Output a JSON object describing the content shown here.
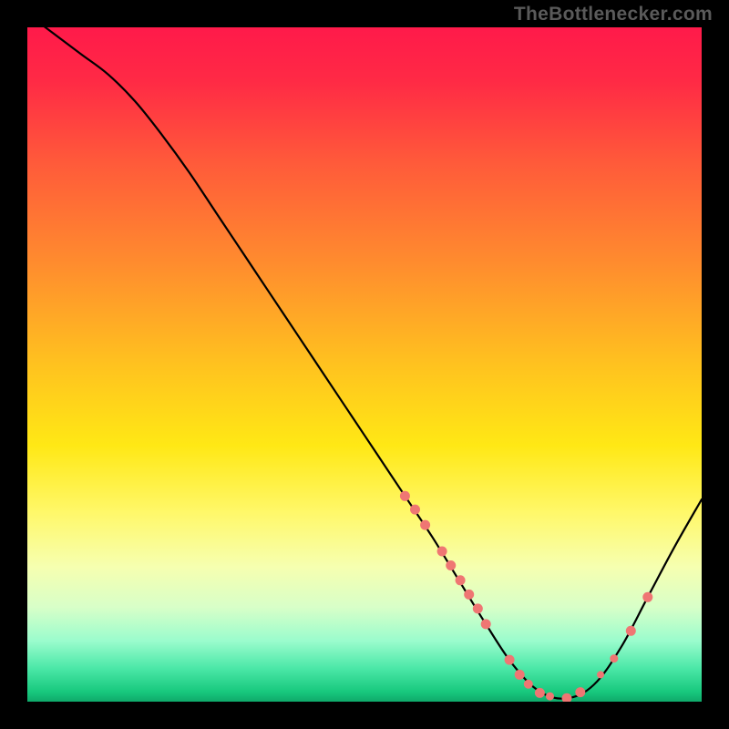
{
  "watermark": "TheBottlenecker.com",
  "gradient": {
    "stops": [
      {
        "offset": 0.0,
        "color": "#ff1a4a"
      },
      {
        "offset": 0.08,
        "color": "#ff2a45"
      },
      {
        "offset": 0.2,
        "color": "#ff5a3a"
      },
      {
        "offset": 0.35,
        "color": "#ff8c2e"
      },
      {
        "offset": 0.5,
        "color": "#ffc21f"
      },
      {
        "offset": 0.62,
        "color": "#ffe815"
      },
      {
        "offset": 0.72,
        "color": "#fff86a"
      },
      {
        "offset": 0.8,
        "color": "#f6ffb0"
      },
      {
        "offset": 0.86,
        "color": "#d8ffc8"
      },
      {
        "offset": 0.91,
        "color": "#9afccd"
      },
      {
        "offset": 0.95,
        "color": "#4ce8a8"
      },
      {
        "offset": 0.985,
        "color": "#18c97e"
      },
      {
        "offset": 1.0,
        "color": "#0fa96a"
      }
    ]
  },
  "chart_data": {
    "type": "line",
    "title": "",
    "xlabel": "",
    "ylabel": "",
    "xlim": [
      0,
      100
    ],
    "ylim": [
      0,
      100
    ],
    "series": [
      {
        "name": "curve",
        "x": [
          0,
          4,
          8,
          12,
          16,
          20,
          24,
          28,
          32,
          36,
          40,
          44,
          48,
          52,
          56,
          60,
          64,
          68,
          72,
          76,
          80,
          84,
          88,
          92,
          96,
          100
        ],
        "y": [
          102,
          99,
          96,
          93,
          89,
          84,
          78.5,
          72.5,
          66.5,
          60.5,
          54.5,
          48.5,
          42.5,
          36.5,
          30.5,
          24.5,
          18.0,
          11.5,
          5.5,
          1.5,
          0.5,
          2.5,
          8.0,
          15.5,
          23.0,
          30.0
        ],
        "stroke": "#000000",
        "width": 2.2
      }
    ],
    "markers": [
      {
        "x": 56.0,
        "y": 30.5,
        "r": 5.5,
        "fill": "#ef7673"
      },
      {
        "x": 57.5,
        "y": 28.5,
        "r": 5.5,
        "fill": "#ef7673"
      },
      {
        "x": 59.0,
        "y": 26.2,
        "r": 5.5,
        "fill": "#ef7673"
      },
      {
        "x": 61.5,
        "y": 22.3,
        "r": 5.5,
        "fill": "#ef7673"
      },
      {
        "x": 62.8,
        "y": 20.2,
        "r": 5.5,
        "fill": "#ef7673"
      },
      {
        "x": 64.2,
        "y": 18.0,
        "r": 5.5,
        "fill": "#ef7673"
      },
      {
        "x": 65.5,
        "y": 15.9,
        "r": 5.5,
        "fill": "#ef7673"
      },
      {
        "x": 66.8,
        "y": 13.8,
        "r": 5.5,
        "fill": "#ef7673"
      },
      {
        "x": 68.0,
        "y": 11.5,
        "r": 5.5,
        "fill": "#ef7673"
      },
      {
        "x": 71.5,
        "y": 6.2,
        "r": 5.5,
        "fill": "#ef7673"
      },
      {
        "x": 73.0,
        "y": 4.0,
        "r": 5.5,
        "fill": "#ef7673"
      },
      {
        "x": 74.3,
        "y": 2.6,
        "r": 5.0,
        "fill": "#ef7673"
      },
      {
        "x": 76.0,
        "y": 1.3,
        "r": 5.5,
        "fill": "#ef7673"
      },
      {
        "x": 77.5,
        "y": 0.8,
        "r": 4.5,
        "fill": "#ef7673"
      },
      {
        "x": 80.0,
        "y": 0.5,
        "r": 5.5,
        "fill": "#ef7673"
      },
      {
        "x": 82.0,
        "y": 1.4,
        "r": 5.5,
        "fill": "#ef7673"
      },
      {
        "x": 85.0,
        "y": 4.0,
        "r": 4.0,
        "fill": "#ef7673"
      },
      {
        "x": 87.0,
        "y": 6.4,
        "r": 4.5,
        "fill": "#ef7673"
      },
      {
        "x": 89.5,
        "y": 10.5,
        "r": 5.5,
        "fill": "#ef7673"
      },
      {
        "x": 92.0,
        "y": 15.5,
        "r": 5.5,
        "fill": "#ef7673"
      }
    ]
  }
}
